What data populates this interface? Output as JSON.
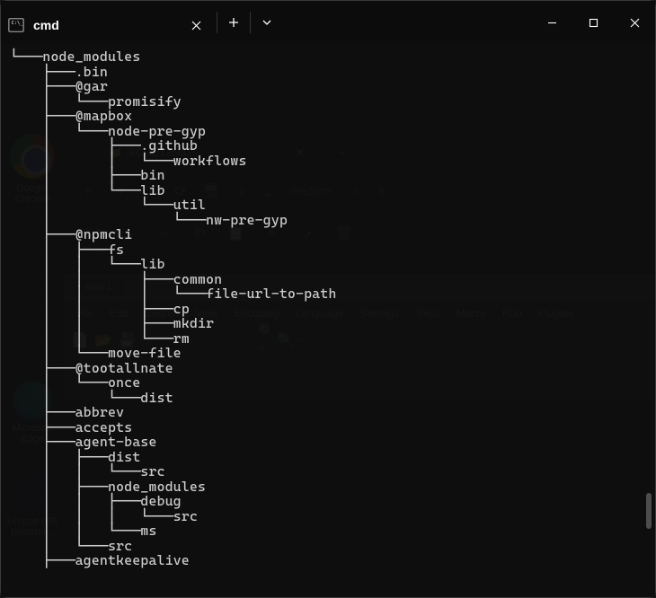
{
  "titlebar": {
    "tab_title": "cmd",
    "new_tab_label": "+",
    "close_label": "✕"
  },
  "tree_output": "└───node_modules\n    ├───.bin\n    ├───@gar\n    │   └───promisify\n    ├───@mapbox\n    │   └───node-pre-gyp\n    │       ├───.github\n    │       │   └───workflows\n    │       ├───bin\n    │       └───lib\n    │           └───util\n    │               └───nw-pre-gyp\n    ├───@npmcli\n    │   ├───fs\n    │   │   └───lib\n    │   │       ├───common\n    │   │       │   └───file-url-to-path\n    │   │       ├───cp\n    │   │       ├───mkdir\n    │   │       └───rm\n    │   └───move-file\n    ├───@tootallnate\n    │   └───once\n    │       └───dist\n    ├───abbrev\n    ├───accepts\n    ├───agent-base\n    │   ├───dist\n    │   │   └───src\n    │   ├───node_modules\n    │   │   ├───debug\n    │   │   │   └───src\n    │   │   └───ms\n    │   └───src\n    ├───agentkeepalive",
  "background": {
    "chrome_label": "Google Chrome",
    "edge_label": "Microsoft Edge",
    "eclipse_label": "Eclipse IDE Enterpri...",
    "explorer_tab": "865a212bfa2e",
    "explorer_breadcrumb_1": "medium",
    "explorer_breadcrumb_2": "8…",
    "explorer_new": "New",
    "notepad_tab": "new 1",
    "notepad_menu": [
      "File",
      "Edit",
      "Search",
      "View",
      "Encoding",
      "Language",
      "Settings",
      "Tools",
      "Macro",
      "Run",
      "Plugins"
    ]
  }
}
